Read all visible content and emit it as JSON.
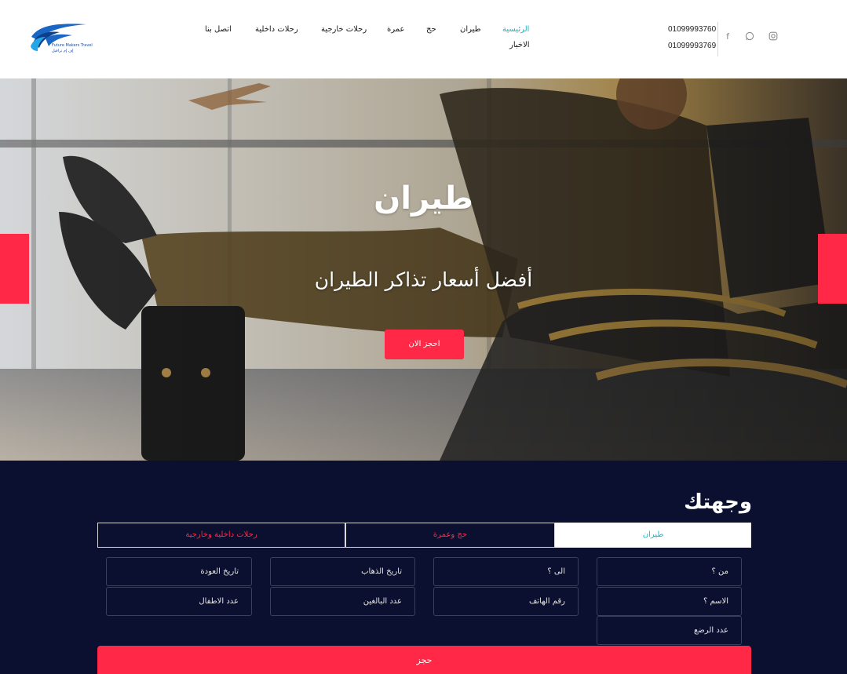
{
  "header": {
    "logo": {
      "line1": "Future Makers Travel",
      "line2": "إف إم ترافيل"
    },
    "nav": [
      {
        "label": "الرئيسية",
        "active": true
      },
      {
        "label": "طيران",
        "active": false
      },
      {
        "label": "حج",
        "active": false
      },
      {
        "label": "عمرة",
        "active": false
      },
      {
        "label": "رحلات خارجية",
        "active": false
      },
      {
        "label": "رحلات داخلية",
        "active": false
      },
      {
        "label": "اتصل بنا",
        "active": false
      },
      {
        "label": "الاخبار",
        "active": false
      }
    ],
    "phones": [
      "01099993760",
      "01099993769"
    ],
    "social": [
      {
        "icon": "facebook-icon",
        "glyph": "f"
      },
      {
        "icon": "whatsapp-icon",
        "glyph": "◎"
      },
      {
        "icon": "instagram-icon",
        "glyph": "◻"
      }
    ]
  },
  "hero": {
    "title": "طيران",
    "subtitle": "أفضل أسعار تذاكر الطيران",
    "cta_label": "احجز الان"
  },
  "booking": {
    "title": "وجهتك",
    "tabs": [
      {
        "label": "طيران",
        "active": true
      },
      {
        "label": "حج وعمرة",
        "active": false
      },
      {
        "label": "رحلات داخلية وخارجية",
        "active": false
      }
    ],
    "fields": {
      "from": "من ؟",
      "to": "الى ؟",
      "departure_date": "تاريخ الذهاب",
      "return_date": "تاريخ العودة",
      "name": "الاسم ؟",
      "phone": "رقم الهاتف",
      "adults": "عدد البالغين",
      "children": "عدد الاطفال",
      "infants": "عدد الرضع"
    },
    "submit_label": "حجز"
  },
  "colors": {
    "accent": "#ff2846",
    "teal": "#19b8c6",
    "navy": "#0b1030"
  }
}
